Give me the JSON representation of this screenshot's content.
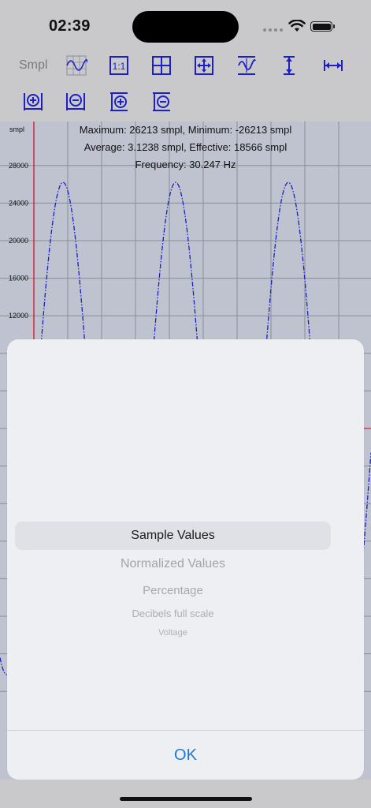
{
  "status": {
    "time": "02:39"
  },
  "toolbar": {
    "label": "Smpl",
    "buttons": [
      {
        "name": "waveform-grid-icon"
      },
      {
        "name": "one-to-one-icon",
        "text": "1:1"
      },
      {
        "name": "grid-icon"
      },
      {
        "name": "move-arrows-icon"
      },
      {
        "name": "fit-waveform-icon"
      },
      {
        "name": "vertical-expand-icon"
      },
      {
        "name": "horizontal-expand-icon"
      },
      {
        "name": "horizontal-zoom-in-icon"
      },
      {
        "name": "horizontal-zoom-out-icon"
      },
      {
        "name": "vertical-zoom-in-icon"
      },
      {
        "name": "vertical-zoom-out-icon"
      }
    ],
    "accent_color": "#1d20c6"
  },
  "chart": {
    "stats_line1": "Maximum: 26213 smpl, Minimum: -26213 smpl",
    "stats_line2": "Average: 3.1238 smpl, Effective: 18566 smpl",
    "stats_line3": "Frequency: 30.247 Hz",
    "y_unit": "smpl"
  },
  "chart_data": {
    "type": "line",
    "y_ticks": [
      "28000",
      "24000",
      "20000",
      "16000",
      "12000"
    ],
    "y_tick_values": [
      28000,
      24000,
      20000,
      16000,
      12000
    ],
    "series": [
      {
        "amplitude": 26213,
        "frequency_hz": 30.247,
        "color": "#1d20c6",
        "style": "dashed"
      }
    ]
  },
  "picker": {
    "options": [
      "Sample Values",
      "Normalized Values",
      "Percentage",
      "Decibels full scale",
      "Voltage"
    ],
    "selected": "Sample Values"
  },
  "sheet": {
    "ok_label": "OK"
  },
  "colors": {
    "link_blue": "#1a7ad9",
    "plot_bg": "#c2c7d4",
    "axis_red": "#e0001a"
  }
}
